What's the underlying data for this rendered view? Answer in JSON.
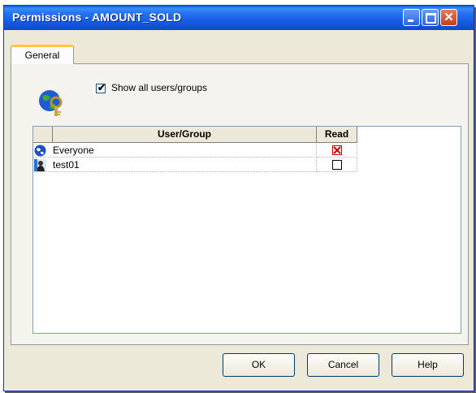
{
  "window": {
    "title": "Permissions - AMOUNT_SOLD",
    "controls": {
      "minimize": "minimize-icon",
      "maximize": "maximize-icon",
      "close": "close-icon",
      "close_glyph": "✕"
    }
  },
  "tabs": [
    {
      "label": "General",
      "selected": true
    }
  ],
  "options": {
    "show_all_label": "Show all users/groups",
    "show_all_checked": true,
    "check_glyph": "✔"
  },
  "grid": {
    "columns": {
      "user": "User/Group",
      "read": "Read"
    },
    "rows": [
      {
        "name": "Everyone",
        "icon": "group-globe-icon",
        "read": true
      },
      {
        "name": "test01",
        "icon": "user-icon",
        "read": false
      }
    ]
  },
  "buttons": {
    "ok": "OK",
    "cancel": "Cancel",
    "help": "Help"
  },
  "colors": {
    "title_bar": "#1758e0",
    "dialog_bg": "#ece9d8",
    "tab_highlight": "#ffc83c",
    "read_check": "#c00000"
  }
}
